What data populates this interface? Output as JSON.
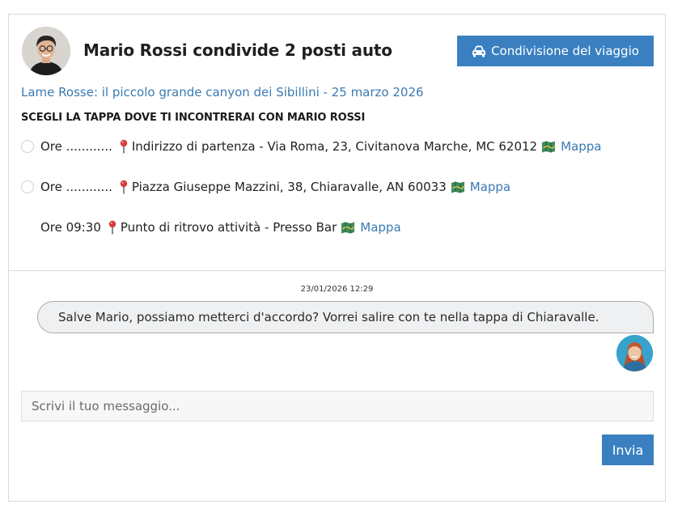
{
  "header": {
    "title": "Mario Rossi condivide 2 posti auto",
    "share_button_label": "Condivisione del viaggio",
    "share_button_icon": "car-icon",
    "accent_color": "#3a80c1"
  },
  "event": {
    "link_text": "Lame Rosse: il piccolo grande canyon dei Sibillini - 25 marzo 2026"
  },
  "stops": {
    "heading": "SCEGLI LA TAPPA DOVE TI INCONTRERAI CON MARIO ROSSI",
    "items": [
      {
        "time": "Ore ............",
        "address": "Indirizzo di partenza - Via Roma, 23, Civitanova Marche, MC 62012",
        "map_label": "Mappa",
        "selectable": true
      },
      {
        "time": "Ore ............",
        "address": "Piazza Giuseppe Mazzini, 38, Chiaravalle, AN 60033",
        "map_label": "Mappa",
        "selectable": true
      },
      {
        "time": "Ore 09:30",
        "address": "Punto di ritrovo attività - Presso Bar",
        "map_label": "Mappa",
        "selectable": false
      }
    ]
  },
  "chat": {
    "messages": [
      {
        "timestamp": "23/01/2026 12:29",
        "text": "Salve Mario, possiamo metterci d'accordo? Vorrei salire con te nella tappa di Chiaravalle."
      }
    ],
    "input_placeholder": "Scrivi il tuo messaggio...",
    "input_value": "",
    "send_label": "Invia"
  }
}
